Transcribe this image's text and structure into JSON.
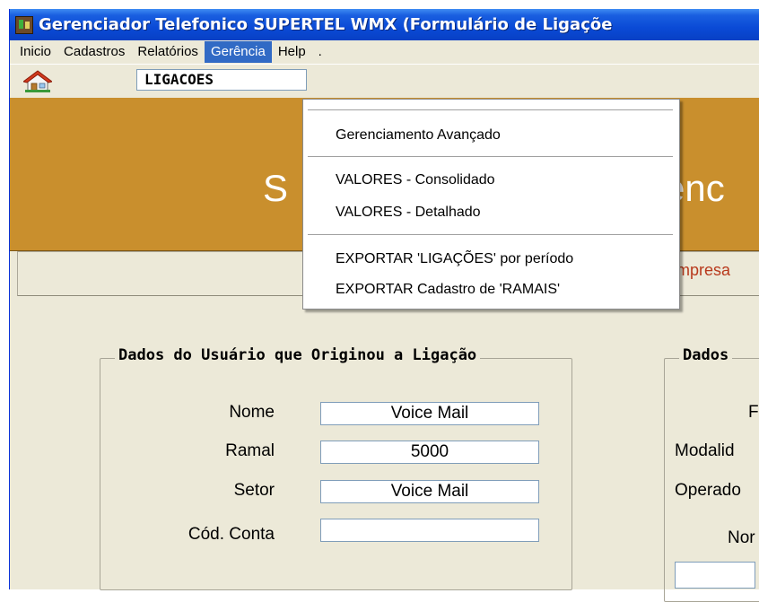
{
  "window": {
    "title": "Gerenciador Telefonico SUPERTEL WMX (Formulário de Ligaçõe"
  },
  "menu": {
    "items": [
      "Inicio",
      "Cadastros",
      "Relatórios",
      "Gerência",
      "Help",
      "."
    ],
    "active": "Gerência"
  },
  "toolbar": {
    "home_icon": "home-icon",
    "combo_value": "LIGACOES"
  },
  "banner": {
    "left_text": "S",
    "right_text": "enc",
    "color": "#c98f2d"
  },
  "tabstrip": {
    "empresa_text": "Empresa"
  },
  "dropdown": {
    "items": [
      "Gerenciamento Avançado",
      "VALORES - Consolidado",
      "VALORES - Detalhado",
      "EXPORTAR 'LIGAÇÕES' por período",
      "EXPORTAR Cadastro de 'RAMAIS'"
    ]
  },
  "user_group": {
    "title": "Dados do Usuário que Originou a Ligação",
    "fields": [
      {
        "label": "Nome",
        "value": "Voice Mail"
      },
      {
        "label": "Ramal",
        "value": "5000"
      },
      {
        "label": "Setor",
        "value": "Voice Mail"
      },
      {
        "label": "Cód. Conta",
        "value": ""
      }
    ]
  },
  "call_group": {
    "title": "Dados",
    "labels": [
      "F",
      "Modalid",
      "Operado",
      "Nor"
    ]
  }
}
